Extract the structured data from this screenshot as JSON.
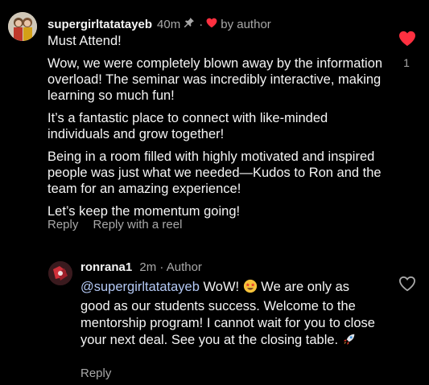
{
  "colors": {
    "background": "#000000",
    "text_primary": "#f5f5f5",
    "text_muted": "#a8a8a8",
    "heart_red": "#ff3040",
    "mention_blue": "#b4c9f5"
  },
  "comment": {
    "username": "supergirltatatayeb",
    "time": "40m",
    "pin_icon": "pin-icon",
    "dot": "·",
    "liked_by_author_icon": "heart-icon",
    "liked_by_author_text": "by author",
    "paragraphs": [
      "Must Attend!",
      "Wow, we were completely blown away by the information overload! The seminar was incredibly interactive, making learning so much fun!",
      "It’s a fantastic place to connect with like-minded individuals and grow together!",
      "Being in a room filled with highly motivated and inspired people was just what we needed—Kudos to Ron and the team for an amazing experience!",
      "Let’s keep the momentum going!"
    ],
    "reply_label": "Reply",
    "reply_with_reel_label": "Reply with a reel",
    "like_icon": "heart-filled-icon",
    "like_count": "1"
  },
  "reply": {
    "username": "ronrana1",
    "time": "2m",
    "dot": "·",
    "badge": "Author",
    "mention": "@supergirltatatayeb",
    "text_before_emoji": " WoW! ",
    "emoji_1": "star-struck-emoji",
    "text_after_emoji": " We are only as good as our students success. Welcome to the mentorship program! I cannot wait for you to close your next deal. See you at the closing table. ",
    "emoji_2": "rocket-emoji",
    "reply_label": "Reply",
    "like_icon": "heart-outline-icon"
  }
}
